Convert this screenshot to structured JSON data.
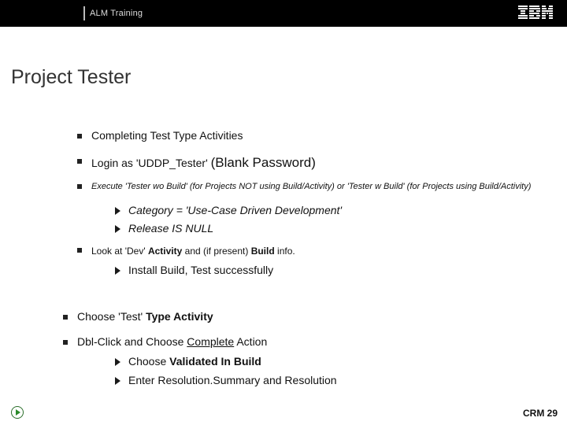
{
  "header": {
    "training": "ALM Training"
  },
  "title": "Project Tester",
  "bul": {
    "b1": "Completing Test Type Activities",
    "b2a": "Login as 'UDDP_Tester' ",
    "b2b": "(Blank Password)",
    "b3": "Execute 'Tester wo Build' (for Projects NOT using Build/Activity) or 'Tester w Build' (for Projects using Build/Activity)",
    "b3s1": "Category = 'Use-Case Driven Development'",
    "b3s2": "Release IS NULL",
    "b4a": "Look at 'Dev' ",
    "b4b": "Activity",
    "b4c": " and (if present) ",
    "b4d": "Build",
    "b4e": " info.",
    "b4s1": "Install Build, Test successfully",
    "b5a": "Choose 'Test' ",
    "b5b": "Type Activity",
    "b6a": "Dbl-Click and Choose ",
    "b6b": "Complete",
    "b6c": " Action",
    "b6s1a": "Choose ",
    "b6s1b": "Validated In Build",
    "b6s2": "Enter Resolution.Summary and Resolution"
  },
  "footer": {
    "right": "CRM 29"
  }
}
